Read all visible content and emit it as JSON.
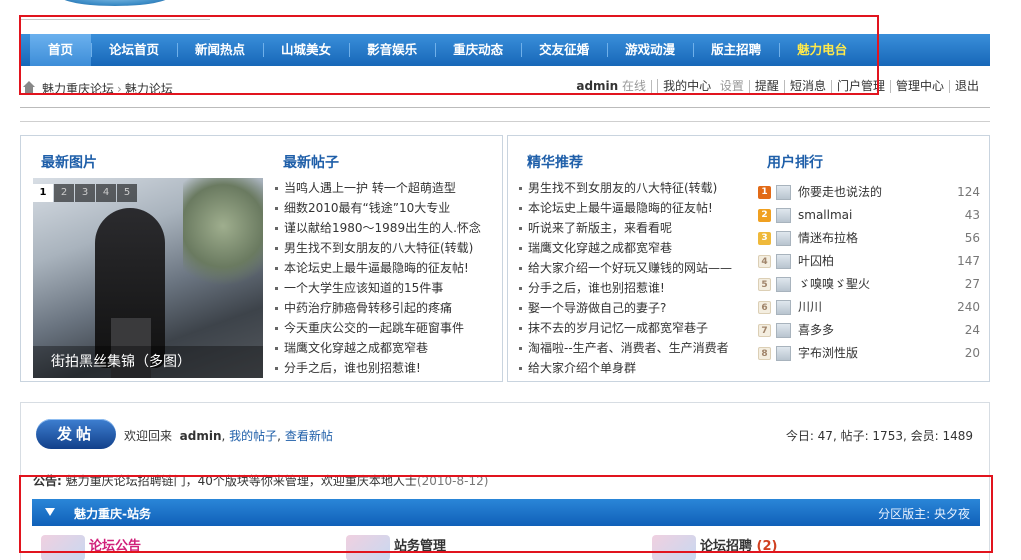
{
  "nav": {
    "items": [
      {
        "label": "首页",
        "active": true
      },
      {
        "label": "论坛首页"
      },
      {
        "label": "新闻热点"
      },
      {
        "label": "山城美女"
      },
      {
        "label": "影音娱乐"
      },
      {
        "label": "重庆动态"
      },
      {
        "label": "交友征婚"
      },
      {
        "label": "游戏动漫"
      },
      {
        "label": "版主招聘"
      },
      {
        "label": "魅力电台",
        "highlight": true
      }
    ]
  },
  "breadcrumb": {
    "home": "魅力重庆论坛",
    "sep": "›",
    "current": "魅力论坛"
  },
  "userbar": {
    "username": "admin",
    "online": "在线",
    "my_center": "我的中心",
    "settings": "设置",
    "remind": "提醒",
    "messages": "短消息",
    "portal": "门户管理",
    "admin_center": "管理中心",
    "logout": "退出"
  },
  "latest_images": {
    "title": "最新图片",
    "pages": [
      "1",
      "2",
      "3",
      "4",
      "5"
    ],
    "caption": "街拍黑丝集锦（多图）"
  },
  "latest_posts": {
    "title": "最新帖子",
    "items": [
      "当鸣人遇上一护  转一个超萌造型",
      "细数2010最有“钱途”10大专业",
      "谨以献给1980～1989出生的人.怀念",
      "男生找不到女朋友的八大特征(转载)",
      "本论坛史上最牛逼最隐晦的征友帖!",
      "一个大学生应该知道的15件事",
      "中药治疗肺癌骨转移引起的疼痛",
      "今天重庆公交的一起跳车砸窗事件",
      "瑞鹰文化穿越之成都宽窄巷",
      "分手之后，谁也别招惹谁!"
    ]
  },
  "featured": {
    "title": "精华推荐",
    "items": [
      "男生找不到女朋友的八大特征(转载)",
      "本论坛史上最牛逼最隐晦的征友帖!",
      "听说来了新版主，来看看呢",
      "瑞鹰文化穿越之成都宽窄巷",
      "给大家介绍一个好玩又赚钱的网站——",
      "分手之后，谁也别招惹谁!",
      "娶一个导游做自己的妻子?",
      "抹不去的岁月记忆一成都宽窄巷子",
      "淘福啦--生产者、消费者、生产消费者",
      "给大家介绍个单身群"
    ]
  },
  "user_rank": {
    "title": "用户排行",
    "items": [
      {
        "rank": "1",
        "name": "你要走也说法的",
        "score": "124"
      },
      {
        "rank": "2",
        "name": "smallmai",
        "score": "43"
      },
      {
        "rank": "3",
        "name": "情迷布拉格",
        "score": "56"
      },
      {
        "rank": "4",
        "name": "叶囚柏",
        "score": "147"
      },
      {
        "rank": "5",
        "name": "ゞ嗅嗅ゞ聖火",
        "score": "27"
      },
      {
        "rank": "6",
        "name": "川川",
        "score": "240"
      },
      {
        "rank": "7",
        "name": "喜多多",
        "score": "24"
      },
      {
        "rank": "8",
        "name": "字布浏性版",
        "score": "20"
      }
    ]
  },
  "board": {
    "post_button": "发帖",
    "welcome_prefix": "欢迎回来",
    "welcome_user": "admin",
    "my_posts": "我的帖子",
    "new_posts": "查看新帖",
    "stats": "今日: 47, 帖子: 1753, 会员: 1489",
    "notice_label": "公告:",
    "notice_text": "魅力重庆论坛招聘链门，40个版块等你来管理，欢迎重庆本地人士",
    "notice_date": "(2010-8-12)",
    "category": "魅力重庆-站务",
    "moderators": "分区版主: 央夕夜",
    "forums": [
      {
        "name": "论坛公告"
      },
      {
        "name": "站务管理"
      },
      {
        "name": "论坛招聘",
        "count": "(2)"
      }
    ]
  }
}
